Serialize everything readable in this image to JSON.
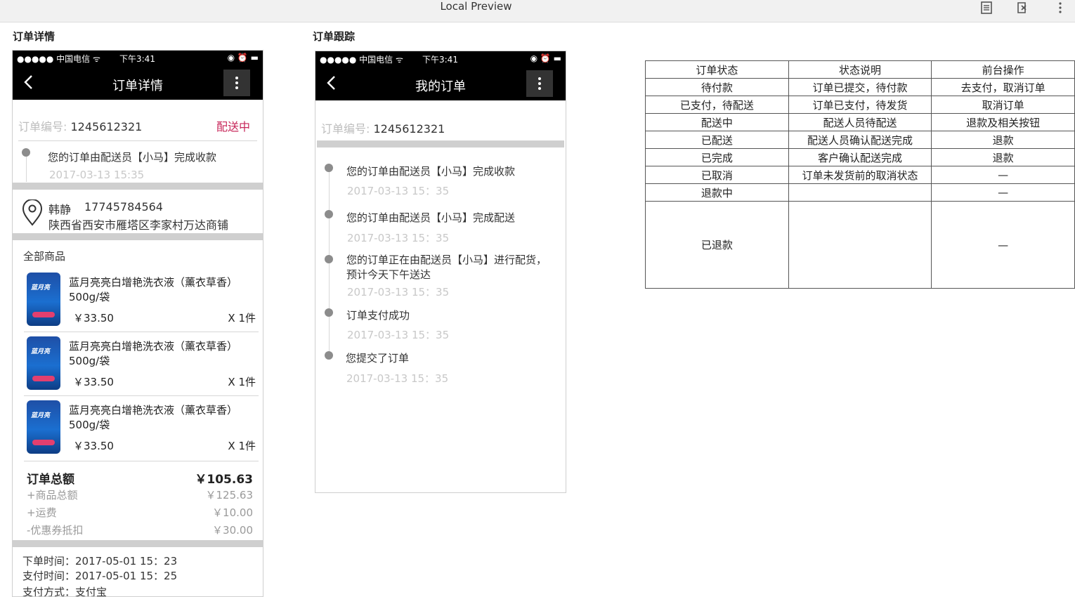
{
  "preview": {
    "title": "Local Preview"
  },
  "sections": {
    "left_title": "订单详情",
    "mid_title": "订单跟踪"
  },
  "statusbar": {
    "carrier": "●●●●● 中国电信 ᯤ",
    "time": "下午3:41",
    "right": "◉ ⏰ ▬"
  },
  "order_detail": {
    "nav_title": "订单详情",
    "order_no_label": "订单编号:",
    "order_no": "1245612321",
    "status": "配送中",
    "latest_event": "您的订单由配送员【小马】完成收款",
    "latest_time": "2017-03-13 15:35",
    "recipient_name": "韩静",
    "recipient_phone": "17745784564",
    "address": "陕西省西安市雁塔区李家村万达商铺",
    "goods_header": "全部商品",
    "products": [
      {
        "name": "蓝月亮亮白增艳洗衣液（薰衣草香）500g/袋",
        "price": "￥33.50",
        "qty": "X 1件"
      },
      {
        "name": "蓝月亮亮白增艳洗衣液（薰衣草香）500g/袋",
        "price": "￥33.50",
        "qty": "X 1件"
      },
      {
        "name": "蓝月亮亮白增艳洗衣液（薰衣草香）500g/袋",
        "price": "￥33.50",
        "qty": "X 1件"
      }
    ],
    "total_label": "订单总额",
    "total_value": "￥105.63",
    "goods_total_label": "+商品总额",
    "goods_total_value": "￥125.63",
    "shipping_label": "+运费",
    "shipping_value": "￥10.00",
    "coupon_label": "-优惠券抵扣",
    "coupon_value": "￥30.00",
    "order_time": "下单时间：2017-05-01  15：23",
    "pay_time": "支付时间：2017-05-01  15：25",
    "pay_method": "支付方式：支付宝"
  },
  "order_tracking": {
    "nav_title": "我的订单",
    "order_no_label": "订单编号:",
    "order_no": "1245612321",
    "events": [
      {
        "text": "您的订单由配送员【小马】完成收款",
        "time": "2017-03-13 15：35"
      },
      {
        "text": "您的订单由配送员【小马】完成配送",
        "time": "2017-03-13 15：35"
      },
      {
        "text": "您的订单正在由配送员【小马】进行配货，预计今天下午送达",
        "time": "2017-03-13 15：35"
      },
      {
        "text": "订单支付成功",
        "time": "2017-03-13 15：35"
      },
      {
        "text": "您提交了订单",
        "time": "2017-03-13 15：35"
      }
    ]
  },
  "status_table": {
    "headers": [
      "订单状态",
      "状态说明",
      "前台操作"
    ],
    "rows": [
      [
        "待付款",
        "订单已提交，待付款",
        "去支付，取消订单"
      ],
      [
        "已支付，待配送",
        "订单已支付，待发货",
        "取消订单"
      ],
      [
        "配送中",
        "配送人员待配送",
        "退款及相关按钮"
      ],
      [
        "已配送",
        "配送人员确认配送完成",
        "退款"
      ],
      [
        "已完成",
        "客户确认配送完成",
        "退款"
      ],
      [
        "已取消",
        "订单未发货前的取消状态",
        "—"
      ],
      [
        "退款中",
        "",
        "—"
      ],
      [
        "已退款",
        "",
        "—"
      ]
    ]
  }
}
